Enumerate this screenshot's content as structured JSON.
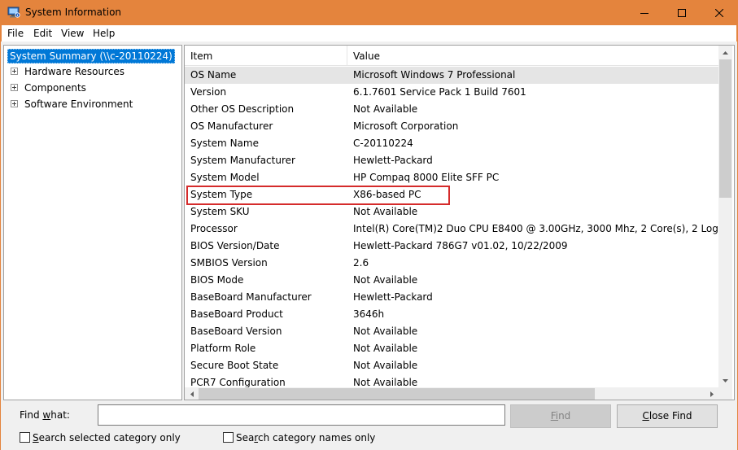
{
  "window": {
    "title": "System Information",
    "accent_color": "#e4843d"
  },
  "menu": [
    "File",
    "Edit",
    "View",
    "Help"
  ],
  "tree": {
    "root": "System Summary (\\\\c-20110224)",
    "children": [
      "Hardware Resources",
      "Components",
      "Software Environment"
    ]
  },
  "list": {
    "headers": {
      "item": "Item",
      "value": "Value"
    },
    "rows": [
      {
        "item": "OS Name",
        "value": "Microsoft Windows 7 Professional"
      },
      {
        "item": "Version",
        "value": "6.1.7601 Service Pack 1 Build 7601"
      },
      {
        "item": "Other OS Description",
        "value": "Not Available"
      },
      {
        "item": "OS Manufacturer",
        "value": "Microsoft Corporation"
      },
      {
        "item": "System Name",
        "value": "C-20110224"
      },
      {
        "item": "System Manufacturer",
        "value": "Hewlett-Packard"
      },
      {
        "item": "System Model",
        "value": "HP Compaq 8000 Elite SFF PC"
      },
      {
        "item": "System Type",
        "value": "X86-based PC"
      },
      {
        "item": "System SKU",
        "value": "Not Available"
      },
      {
        "item": "Processor",
        "value": "Intel(R) Core(TM)2 Duo CPU     E8400  @ 3.00GHz, 3000 Mhz, 2 Core(s), 2 Log"
      },
      {
        "item": "BIOS Version/Date",
        "value": "Hewlett-Packard 786G7 v01.02, 10/22/2009"
      },
      {
        "item": "SMBIOS Version",
        "value": "2.6"
      },
      {
        "item": "BIOS Mode",
        "value": "Not Available"
      },
      {
        "item": "BaseBoard Manufacturer",
        "value": "Hewlett-Packard"
      },
      {
        "item": "BaseBoard Product",
        "value": "3646h"
      },
      {
        "item": "BaseBoard Version",
        "value": "Not Available"
      },
      {
        "item": "Platform Role",
        "value": "Not Available"
      },
      {
        "item": "Secure Boot State",
        "value": "Not Available"
      },
      {
        "item": "PCR7 Configuration",
        "value": "Not Available"
      }
    ],
    "selected_row": 0,
    "highlighted_row": 7,
    "highlight_color": "#d52b2b"
  },
  "find": {
    "label_prefix": "Find ",
    "label_underlined": "w",
    "label_suffix": "hat:",
    "input_value": "",
    "find_button_underlined": "Fi",
    "find_button_suffix": "nd",
    "close_find_underlined": "C",
    "close_find_suffix": "lose Find",
    "check1_underlined": "S",
    "check1_suffix": "earch selected category only",
    "check2_prefix": "Sea",
    "check2_underlined": "r",
    "check2_suffix": "ch category names only"
  }
}
